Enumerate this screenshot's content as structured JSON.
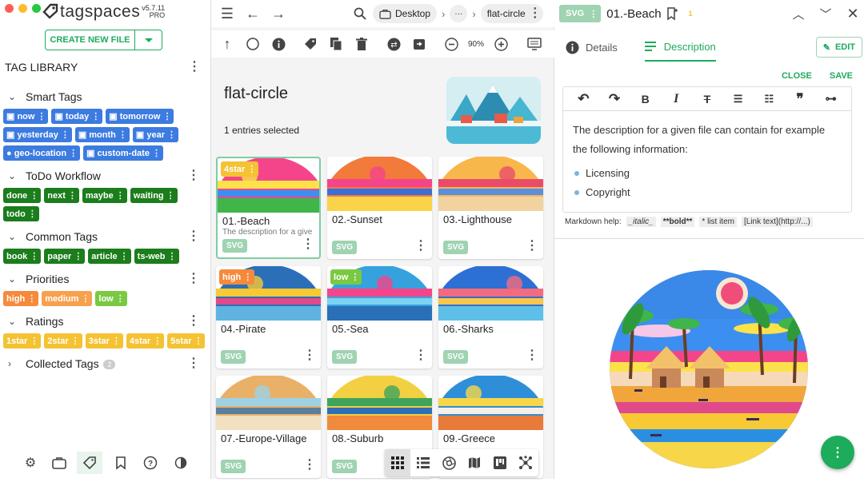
{
  "app": {
    "logo_text": "tagspaces",
    "version": "v5.7.11",
    "edition": "PRO"
  },
  "left": {
    "create_button": "CREATE NEW FILE",
    "library_title": "TAG LIBRARY",
    "groups": {
      "smart": {
        "name": "Smart Tags",
        "tags": [
          "now",
          "today",
          "tomorrow",
          "yesterday",
          "month",
          "year",
          "geo-location",
          "custom-date"
        ]
      },
      "todo": {
        "name": "ToDo Workflow",
        "tags": [
          "done",
          "next",
          "maybe",
          "waiting",
          "todo"
        ]
      },
      "common": {
        "name": "Common Tags",
        "tags": [
          "book",
          "paper",
          "article",
          "ts-web"
        ]
      },
      "priorities": {
        "name": "Priorities",
        "tags": [
          "high",
          "medium",
          "low"
        ]
      },
      "ratings": {
        "name": "Ratings",
        "tags": [
          "1star",
          "2star",
          "3star",
          "4star",
          "5star"
        ]
      },
      "collected": {
        "name": "Collected Tags",
        "count": "2"
      }
    }
  },
  "mid": {
    "breadcrumb": {
      "location": "Desktop",
      "ellipsis": "···",
      "folder": "flat-circle"
    },
    "zoom": "90%",
    "folder_title": "flat-circle",
    "selection_info": "1 entries selected",
    "cards": [
      {
        "title": "01.-Beach",
        "desc": "The description for a give",
        "ext": "SVG",
        "tag": "4star"
      },
      {
        "title": "02.-Sunset",
        "desc": "",
        "ext": "SVG",
        "tag": ""
      },
      {
        "title": "03.-Lighthouse",
        "desc": "",
        "ext": "SVG",
        "tag": ""
      },
      {
        "title": "04.-Pirate",
        "desc": "",
        "ext": "SVG",
        "tag": "high"
      },
      {
        "title": "05.-Sea",
        "desc": "",
        "ext": "SVG",
        "tag": "low"
      },
      {
        "title": "06.-Sharks",
        "desc": "",
        "ext": "SVG",
        "tag": ""
      },
      {
        "title": "07.-Europe-Village",
        "desc": "",
        "ext": "SVG",
        "tag": ""
      },
      {
        "title": "08.-Suburb",
        "desc": "",
        "ext": "SVG",
        "tag": ""
      },
      {
        "title": "09.-Greece",
        "desc": "",
        "ext": "",
        "tag": ""
      }
    ]
  },
  "right": {
    "ext": "SVG",
    "file_title": "01.-Beach",
    "rev": "1",
    "tabs": {
      "details": "Details",
      "description": "Description"
    },
    "edit": "EDIT",
    "close": "CLOSE",
    "save": "SAVE",
    "desc_text": "The description for a given file can contain for example the following information:",
    "bullets": [
      "Licensing",
      "Copyright"
    ],
    "md_help": {
      "label": "Markdown help:",
      "italic": "_italic_",
      "bold": "**bold**",
      "list": "* list item",
      "link": "[Link text](http://...)"
    }
  },
  "colors": {
    "accent": "#1dab5c",
    "selection": "#7fcda2",
    "smart": "#3c7be0",
    "todo": "#1b7d1b",
    "high": "#f58a3c",
    "low": "#7ac943",
    "rating": "#f4c232"
  }
}
